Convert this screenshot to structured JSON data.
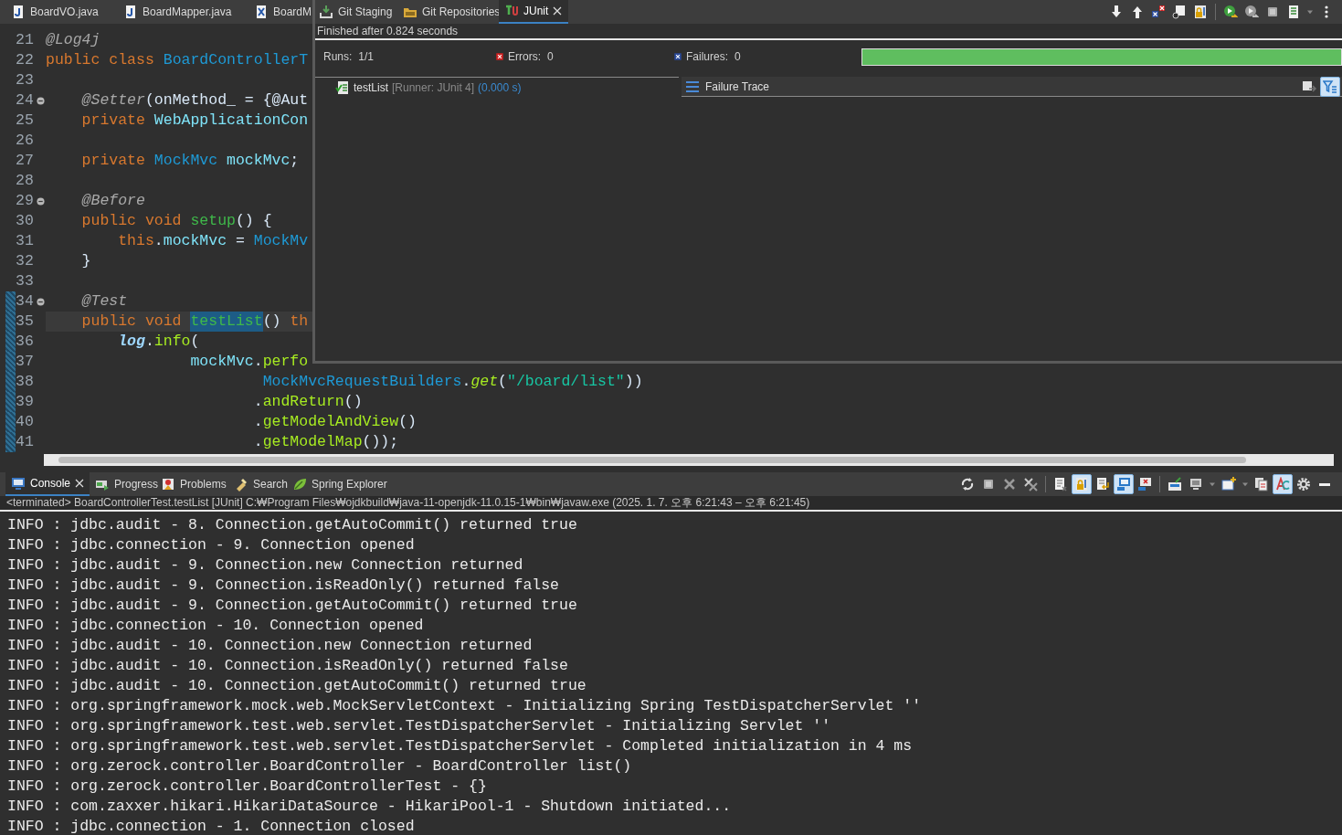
{
  "editor": {
    "tabs": [
      {
        "label": "BoardVO.java",
        "kind": "java",
        "selected": false
      },
      {
        "label": "BoardMapper.java",
        "kind": "java",
        "selected": false
      },
      {
        "label": "BoardM",
        "kind": "xml",
        "selected": false
      }
    ],
    "lines": [
      {
        "number": "21",
        "foldable": false,
        "changed": false,
        "current": false,
        "tokens": [
          {
            "text": "@Log4j",
            "kind": "annotation"
          }
        ]
      },
      {
        "number": "22",
        "foldable": false,
        "changed": false,
        "current": false,
        "tokens": [
          {
            "text": "public class ",
            "kind": "keyword"
          },
          {
            "text": "BoardControllerT",
            "kind": "type"
          }
        ]
      },
      {
        "number": "23",
        "foldable": false,
        "changed": false,
        "current": false
      },
      {
        "number": "24",
        "foldable": true,
        "changed": false,
        "current": false,
        "tokens": [
          {
            "text": "    @Setter",
            "kind": "annotation"
          },
          {
            "text": "(onMethod_ = {@Aut",
            "kind": "plain"
          }
        ]
      },
      {
        "number": "25",
        "foldable": false,
        "changed": false,
        "current": false,
        "tokens": [
          {
            "text": "    private ",
            "kind": "keyword"
          },
          {
            "text": "WebApplicationCon",
            "kind": "interface"
          }
        ]
      },
      {
        "number": "26",
        "foldable": false,
        "changed": false,
        "current": false
      },
      {
        "number": "27",
        "foldable": false,
        "changed": false,
        "current": false,
        "tokens": [
          {
            "text": "    private ",
            "kind": "keyword"
          },
          {
            "text": "MockMvc ",
            "kind": "type"
          },
          {
            "text": "mockMvc",
            "kind": "field"
          },
          {
            "text": ";",
            "kind": "plain"
          }
        ]
      },
      {
        "number": "28",
        "foldable": false,
        "changed": false,
        "current": false
      },
      {
        "number": "29",
        "foldable": true,
        "changed": false,
        "current": false,
        "tokens": [
          {
            "text": "    @Before",
            "kind": "annotation"
          }
        ]
      },
      {
        "number": "30",
        "foldable": false,
        "changed": false,
        "current": false,
        "tokens": [
          {
            "text": "    public void ",
            "kind": "keyword"
          },
          {
            "text": "setup",
            "kind": "method-declaration"
          },
          {
            "text": "() {",
            "kind": "plain"
          }
        ]
      },
      {
        "number": "31",
        "foldable": false,
        "changed": false,
        "current": false,
        "tokens": [
          {
            "text": "        this",
            "kind": "keyword"
          },
          {
            "text": ".",
            "kind": "plain"
          },
          {
            "text": "mockMvc",
            "kind": "field"
          },
          {
            "text": " = ",
            "kind": "plain"
          },
          {
            "text": "MockMv",
            "kind": "type"
          }
        ]
      },
      {
        "number": "32",
        "foldable": false,
        "changed": false,
        "current": false,
        "tokens": [
          {
            "text": "    }",
            "kind": "plain"
          }
        ]
      },
      {
        "number": "33",
        "foldable": false,
        "changed": false,
        "current": false
      },
      {
        "number": "34",
        "foldable": true,
        "changed": true,
        "current": false,
        "tokens": [
          {
            "text": "    @Test",
            "kind": "annotation"
          }
        ]
      },
      {
        "number": "35",
        "foldable": false,
        "changed": true,
        "current": true,
        "tokens": [
          {
            "text": "    public void ",
            "kind": "keyword"
          },
          {
            "text": "testList",
            "kind": "occurrence"
          },
          {
            "text": "() ",
            "kind": "plain"
          },
          {
            "text": "th",
            "kind": "keyword"
          }
        ]
      },
      {
        "number": "36",
        "foldable": false,
        "changed": true,
        "current": false,
        "tokens": [
          {
            "text": "        log",
            "kind": "static-field"
          },
          {
            "text": ".",
            "kind": "plain"
          },
          {
            "text": "info",
            "kind": "method-call"
          },
          {
            "text": "(",
            "kind": "plain"
          }
        ]
      },
      {
        "number": "37",
        "foldable": false,
        "changed": true,
        "current": false,
        "tokens": [
          {
            "text": "                mockMvc",
            "kind": "field"
          },
          {
            "text": ".",
            "kind": "plain"
          },
          {
            "text": "perfo",
            "kind": "method-call"
          }
        ]
      },
      {
        "number": "38",
        "foldable": false,
        "changed": true,
        "current": false,
        "tokens": [
          {
            "text": "                        MockMvcRequestBuilders",
            "kind": "type"
          },
          {
            "text": ".",
            "kind": "plain"
          },
          {
            "text": "get",
            "kind": "static-method"
          },
          {
            "text": "(",
            "kind": "plain"
          },
          {
            "text": "\"/board/list\"",
            "kind": "string"
          },
          {
            "text": "))",
            "kind": "plain"
          }
        ]
      },
      {
        "number": "39",
        "foldable": false,
        "changed": true,
        "current": false,
        "tokens": [
          {
            "text": "                       .",
            "kind": "plain"
          },
          {
            "text": "andReturn",
            "kind": "method-call"
          },
          {
            "text": "()",
            "kind": "plain"
          }
        ]
      },
      {
        "number": "40",
        "foldable": false,
        "changed": true,
        "current": false,
        "tokens": [
          {
            "text": "                       .",
            "kind": "plain"
          },
          {
            "text": "getModelAndView",
            "kind": "method-call"
          },
          {
            "text": "()",
            "kind": "plain"
          }
        ]
      },
      {
        "number": "41",
        "foldable": false,
        "changed": true,
        "current": false,
        "tokens": [
          {
            "text": "                       .",
            "kind": "plain"
          },
          {
            "text": "getModelMap",
            "kind": "method-call"
          },
          {
            "text": "());",
            "kind": "plain"
          }
        ]
      }
    ]
  },
  "junit": {
    "tabs": [
      {
        "label": "Git Staging",
        "kind": "git-staging",
        "selected": false,
        "closable": false
      },
      {
        "label": "Git Repositories",
        "kind": "git-repositories",
        "selected": false,
        "closable": false
      },
      {
        "label": "JUnit",
        "kind": "junit",
        "selected": true,
        "closable": true
      }
    ],
    "toolbar": [
      {
        "kind": "arrow-down",
        "pressed": false
      },
      {
        "kind": "arrow-up",
        "pressed": false
      },
      {
        "kind": "failures-only",
        "pressed": false
      },
      {
        "kind": "history",
        "pressed": false
      },
      {
        "kind": "lock",
        "pressed": false
      },
      {
        "kind": "separator"
      },
      {
        "kind": "rerun",
        "pressed": false
      },
      {
        "kind": "rerun-failed",
        "pressed": false
      },
      {
        "kind": "stop",
        "pressed": false
      },
      {
        "kind": "layout",
        "pressed": false
      },
      {
        "kind": "caret",
        "pressed": false
      },
      {
        "kind": "more",
        "pressed": false
      }
    ],
    "status": "Finished after 0.824 seconds",
    "counters": [
      {
        "kind": "runs",
        "label": "Runs:",
        "value": "1/1"
      },
      {
        "kind": "errors",
        "label": "Errors:",
        "value": "0"
      },
      {
        "kind": "failures",
        "label": "Failures:",
        "value": "0"
      }
    ],
    "progress": {
      "level": 1
    },
    "tests": [
      {
        "name": "testList",
        "runner": "[Runner: JUnit 4]",
        "time": "(0.000 s)",
        "passed": true
      }
    ],
    "failure_trace": {
      "title": "Failure Trace",
      "toolbar": [
        {
          "kind": "compare",
          "pressed": false
        },
        {
          "kind": "filter",
          "pressed": true
        }
      ]
    }
  },
  "console": {
    "tabs": [
      {
        "label": "Console",
        "kind": "console",
        "selected": true,
        "closable": true
      },
      {
        "label": "Progress",
        "kind": "progress",
        "selected": false,
        "closable": false
      },
      {
        "label": "Problems",
        "kind": "problems",
        "selected": false,
        "closable": false
      },
      {
        "label": "Search",
        "kind": "search",
        "selected": false,
        "closable": false
      },
      {
        "label": "Spring Explorer",
        "kind": "spring",
        "selected": false,
        "closable": false
      }
    ],
    "toolbar": [
      {
        "kind": "sync",
        "pressed": false
      },
      {
        "kind": "stop",
        "pressed": false
      },
      {
        "kind": "remove",
        "pressed": false
      },
      {
        "kind": "remove-all",
        "pressed": false
      },
      {
        "kind": "separator"
      },
      {
        "kind": "clear",
        "pressed": false
      },
      {
        "kind": "lock",
        "pressed": true
      },
      {
        "kind": "word-wrap",
        "pressed": false
      },
      {
        "kind": "stdout",
        "pressed": true
      },
      {
        "kind": "stderr",
        "pressed": false
      },
      {
        "kind": "separator"
      },
      {
        "kind": "pin",
        "pressed": false
      },
      {
        "kind": "display",
        "pressed": false
      },
      {
        "kind": "caret",
        "pressed": false
      },
      {
        "kind": "new-console",
        "pressed": false
      },
      {
        "kind": "caret",
        "pressed": false
      },
      {
        "kind": "copy",
        "pressed": false
      },
      {
        "kind": "ansi",
        "pressed": true
      },
      {
        "kind": "gear",
        "pressed": false
      },
      {
        "kind": "minimize",
        "pressed": false
      }
    ],
    "status": "<terminated> BoardControllerTest.testList [JUnit] C:₩Program Files₩ojdkbuild₩java-11-openjdk-11.0.15-1₩bin₩javaw.exe  (2025. 1. 7. 오후 6:21:43 – 오후 6:21:45)",
    "lines": [
      "INFO : jdbc.audit - 8. Connection.getAutoCommit() returned true",
      "INFO : jdbc.connection - 9. Connection opened",
      "INFO : jdbc.audit - 9. Connection.new Connection returned",
      "INFO : jdbc.audit - 9. Connection.isReadOnly() returned false",
      "INFO : jdbc.audit - 9. Connection.getAutoCommit() returned true",
      "INFO : jdbc.connection - 10. Connection opened",
      "INFO : jdbc.audit - 10. Connection.new Connection returned",
      "INFO : jdbc.audit - 10. Connection.isReadOnly() returned false",
      "INFO : jdbc.audit - 10. Connection.getAutoCommit() returned true",
      "INFO : org.springframework.mock.web.MockServletContext - Initializing Spring TestDispatcherServlet ''",
      "INFO : org.springframework.test.web.servlet.TestDispatcherServlet - Initializing Servlet ''",
      "INFO : org.springframework.test.web.servlet.TestDispatcherServlet - Completed initialization in 4 ms",
      "INFO : org.zerock.controller.BoardController - BoardController list()",
      "INFO : org.zerock.controller.BoardControllerTest - {}",
      "INFO : com.zaxxer.hikari.HikariDataSource - HikariPool-1 - Shutdown initiated...",
      "INFO : jdbc.connection - 1. Connection closed"
    ]
  }
}
